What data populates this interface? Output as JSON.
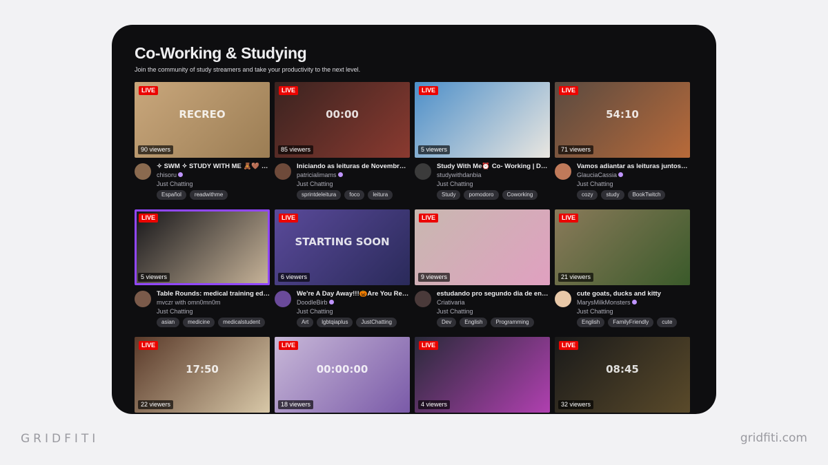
{
  "header": {
    "title": "Co-Working & Studying",
    "subtitle": "Join the community of study streamers and take your productivity to the next level."
  },
  "live_label": "LIVE",
  "cards": [
    {
      "title": "✧ SWM ✧ STUDY WITH ME 🧸🤎 (/◕...",
      "channel": "chisoru",
      "verified": true,
      "category": "Just Chatting",
      "tags": [
        "Español",
        "readwithme"
      ],
      "viewers": "90 viewers",
      "bg": "#c9a77c",
      "bg2": "#9b7d54",
      "avatar": "#8a6a4f",
      "thumb_text": "RECREO",
      "highlight": false
    },
    {
      "title": "Iniciando as leituras de Novembro 📚...",
      "channel": "patricialimams",
      "verified": true,
      "category": "Just Chatting",
      "tags": [
        "sprintdeleitura",
        "foco",
        "leitura"
      ],
      "viewers": "85 viewers",
      "bg": "#3a2320",
      "bg2": "#8a3a30",
      "avatar": "#6e4a3a",
      "thumb_text": "00:00",
      "highlight": false
    },
    {
      "title": "Study With Me⏰ Co- Working | Dail...",
      "channel": "studywithdanbia",
      "verified": false,
      "category": "Just Chatting",
      "tags": [
        "Study",
        "pomodoro",
        "Coworking"
      ],
      "viewers": "5 viewers",
      "bg": "#4d8fc9",
      "bg2": "#e9e6e0",
      "avatar": "#3b3b3b",
      "thumb_text": "",
      "highlight": false
    },
    {
      "title": "Vamos adiantar as leituras juntos? 📚",
      "channel": "GlauciaCassia",
      "verified": true,
      "category": "Just Chatting",
      "tags": [
        "cozy",
        "study",
        "BookTwitch"
      ],
      "viewers": "71 viewers",
      "bg": "#5a4a40",
      "bg2": "#b86a3a",
      "avatar": "#c07a5a",
      "thumb_text": "54:10",
      "highlight": false
    },
    {
      "title": "Table Rounds: medical training editi...",
      "channel": "mvczr with omn0mn0m",
      "verified": false,
      "category": "Just Chatting",
      "tags": [
        "asian",
        "medicine",
        "medicalstudent"
      ],
      "viewers": "5 viewers",
      "bg": "#141418",
      "bg2": "#c9b59a",
      "avatar": "#7a5a4a",
      "thumb_text": "",
      "highlight": true
    },
    {
      "title": "We're A Day Away!!!🎃Are You Ready...",
      "channel": "DoodleBirb",
      "verified": true,
      "category": "Just Chatting",
      "tags": [
        "Art",
        "lgbtqiaplus",
        "JustChatting"
      ],
      "viewers": "6 viewers",
      "bg": "#5a4a9a",
      "bg2": "#2a2a5a",
      "avatar": "#6a4a9a",
      "thumb_text": "STARTING SOON",
      "highlight": false
    },
    {
      "title": "estudando pro segundo dia de enem...",
      "channel": "Criativaria",
      "verified": false,
      "category": "Just Chatting",
      "tags": [
        "Dev",
        "English",
        "Programming"
      ],
      "viewers": "9 viewers",
      "bg": "#c8b8b0",
      "bg2": "#e0a0c0",
      "avatar": "#4a3a3a",
      "thumb_text": "",
      "highlight": false
    },
    {
      "title": "cute goats, ducks and kitty",
      "channel": "MarysMilkMonsters",
      "verified": true,
      "category": "Just Chatting",
      "tags": [
        "English",
        "FamilyFriendly",
        "cute"
      ],
      "viewers": "21 viewers",
      "bg": "#8a7a5a",
      "bg2": "#3a5a2a",
      "avatar": "#e8c8a8",
      "thumb_text": "",
      "highlight": false
    },
    {
      "title": "",
      "channel": "",
      "verified": false,
      "category": "",
      "tags": [],
      "viewers": "22 viewers",
      "bg": "#5a3a2a",
      "bg2": "#d8c8a8",
      "avatar": "#000",
      "thumb_text": "17:50",
      "highlight": false
    },
    {
      "title": "",
      "channel": "",
      "verified": false,
      "category": "",
      "tags": [],
      "viewers": "18 viewers",
      "bg": "#c8b8d8",
      "bg2": "#7a5aa8",
      "avatar": "#000",
      "thumb_text": "00:00:00",
      "highlight": false
    },
    {
      "title": "",
      "channel": "",
      "verified": false,
      "category": "",
      "tags": [],
      "viewers": "4 viewers",
      "bg": "#2a2a3a",
      "bg2": "#b040b0",
      "avatar": "#000",
      "thumb_text": "",
      "highlight": false
    },
    {
      "title": "",
      "channel": "",
      "verified": false,
      "category": "",
      "tags": [],
      "viewers": "32 viewers",
      "bg": "#1a1a1a",
      "bg2": "#5a4a2a",
      "avatar": "#000",
      "thumb_text": "08:45",
      "highlight": false
    }
  ],
  "footer": {
    "brand_left": "GRIDFITI",
    "brand_right": "gridfiti.com"
  }
}
